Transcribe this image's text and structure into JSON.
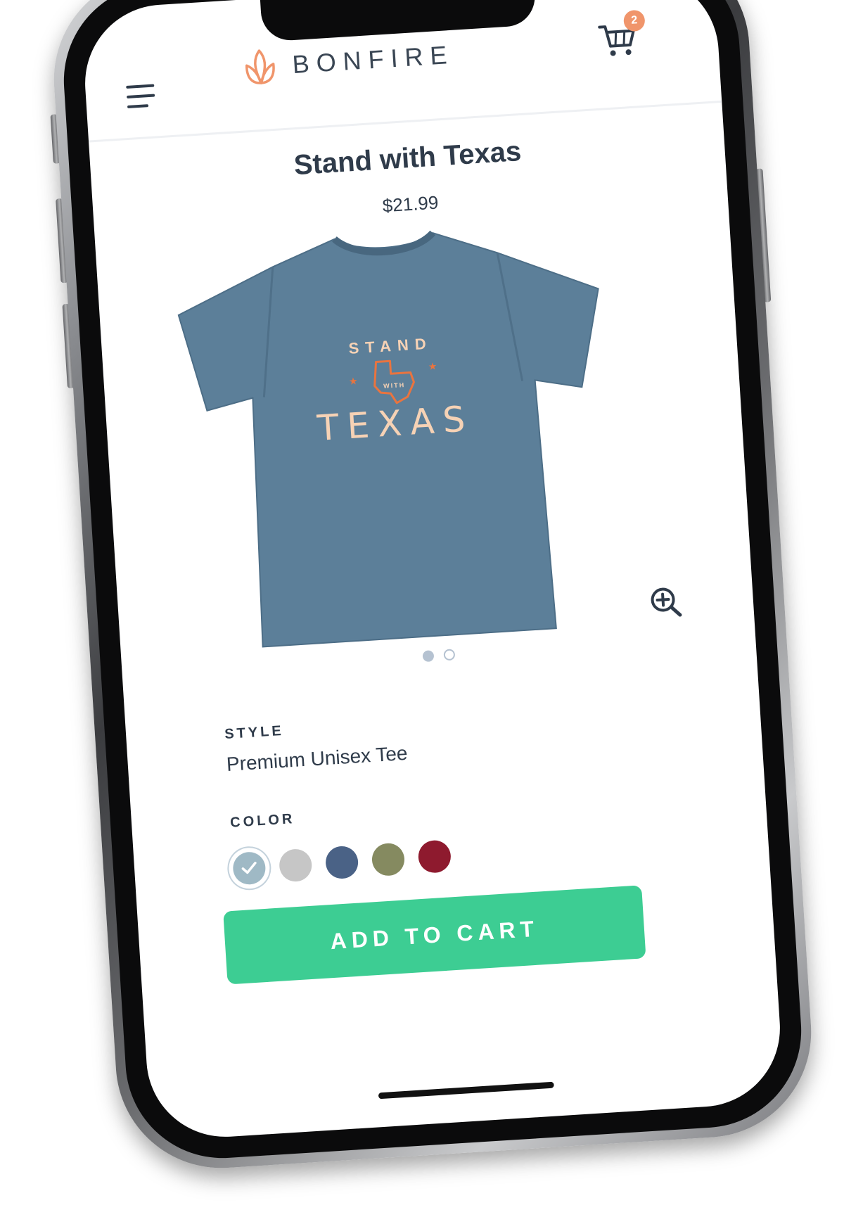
{
  "header": {
    "brand": "BONFIRE",
    "cart_count": "2"
  },
  "product": {
    "title": "Stand with Texas",
    "price": "$21.99",
    "image_text": {
      "line1": "STAND",
      "line2": "WITH",
      "line3": "TEXAS"
    }
  },
  "gallery": {
    "dots": [
      {
        "state": "active"
      },
      {
        "state": "inactive"
      }
    ]
  },
  "style": {
    "label": "STYLE",
    "value": "Premium Unisex Tee"
  },
  "color": {
    "label": "COLOR",
    "swatches": [
      {
        "hex": "#9fb9c5",
        "selected": true
      },
      {
        "hex": "#c6c6c6",
        "selected": false
      },
      {
        "hex": "#4a6286",
        "selected": false
      },
      {
        "hex": "#858a60",
        "selected": false
      },
      {
        "hex": "#8e1a2e",
        "selected": false
      }
    ]
  },
  "cta": {
    "label": "ADD TO CART"
  },
  "colors": {
    "accent": "#3dcd93",
    "brand": "#f0956b",
    "text": "#2f3b4a",
    "shirt": "#5c7f99"
  },
  "icons": [
    "menu-icon",
    "bonfire-logo-icon",
    "cart-icon",
    "zoom-in-icon",
    "check-icon"
  ]
}
